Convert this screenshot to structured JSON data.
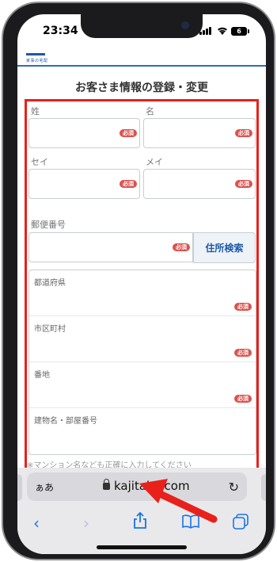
{
  "status_bar": {
    "time": "23:34",
    "battery": "6"
  },
  "header": {
    "logo_text": "家事の宅配"
  },
  "form": {
    "title": "お客さま情報の登録・変更",
    "required_badge": "必須",
    "fields": {
      "sei": "姓",
      "mei": "名",
      "sei_kana": "セイ",
      "mei_kana": "メイ",
      "postal": "郵便番号",
      "prefecture": "都道府県",
      "city": "市区町村",
      "street": "番地",
      "building": "建物名・部屋番号"
    },
    "zip_search_label": "住所検索",
    "note": "※マンション名なども正確に入力してください"
  },
  "safari": {
    "aa_label": "ぁあ",
    "url": "kajitaku.com",
    "reload_icon": "reload-icon",
    "toolbar": [
      "back-icon",
      "forward-icon",
      "share-icon",
      "bookmarks-icon",
      "tabs-icon"
    ]
  },
  "colors": {
    "highlight": "#e8211a",
    "required": "#d9534f",
    "link": "#1e5aa8"
  }
}
